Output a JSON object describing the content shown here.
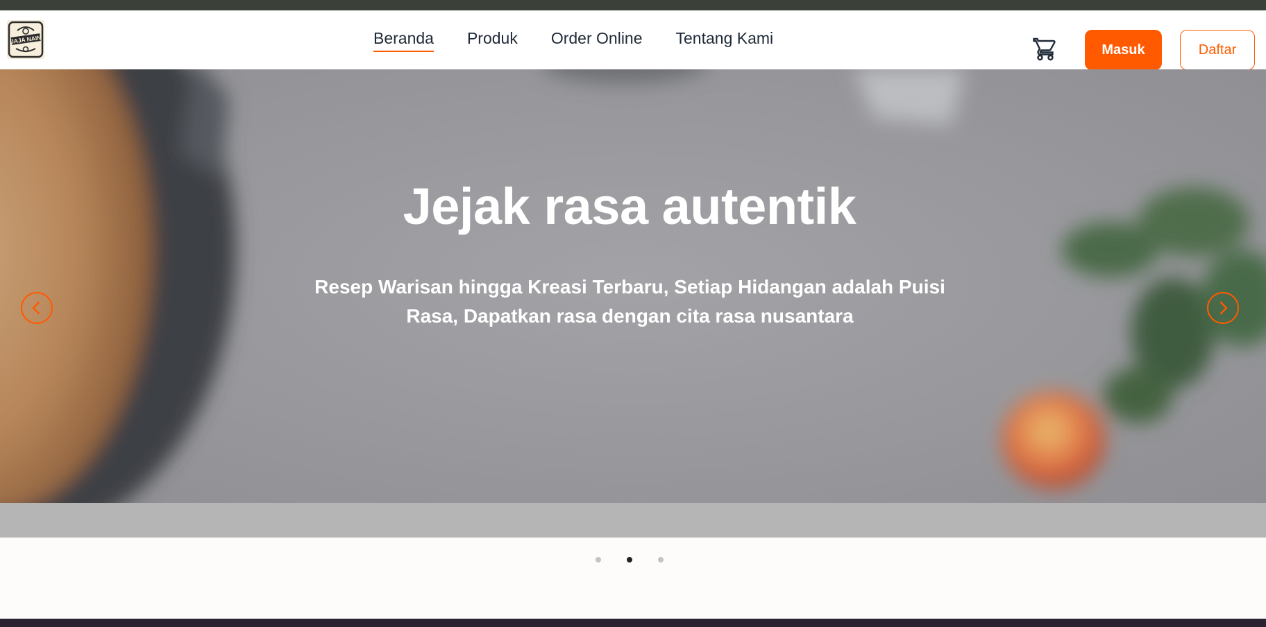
{
  "brand": {
    "logo_alt": "Jaja Nain",
    "logo_text": "JAJA NAIN",
    "logo_icon": "bakery-logo-icon"
  },
  "nav": {
    "links": [
      {
        "label": "Beranda",
        "active": true
      },
      {
        "label": "Produk",
        "active": false
      },
      {
        "label": "Order Online",
        "active": false
      },
      {
        "label": "Tentang Kami",
        "active": false
      }
    ],
    "cart_icon": "cart-icon",
    "login_label": "Masuk",
    "register_label": "Daftar"
  },
  "hero": {
    "title": "Jejak rasa autentik",
    "subtitle": "Resep Warisan hingga Kreasi Terbaru, Setiap Hidangan adalah Puisi Rasa, Dapatkan rasa dengan cita rasa nusantara",
    "prev_icon": "chevron-left-icon",
    "next_icon": "chevron-right-icon"
  },
  "carousel": {
    "slide_count": 3,
    "active_index": 1
  },
  "colors": {
    "accent": "#ff5a00",
    "nav_text": "#1f2937",
    "hero_text": "#ffffff",
    "top_strip": "#3b4038",
    "dot_active": "#222222",
    "dot_inactive": "#c4c4c4"
  }
}
